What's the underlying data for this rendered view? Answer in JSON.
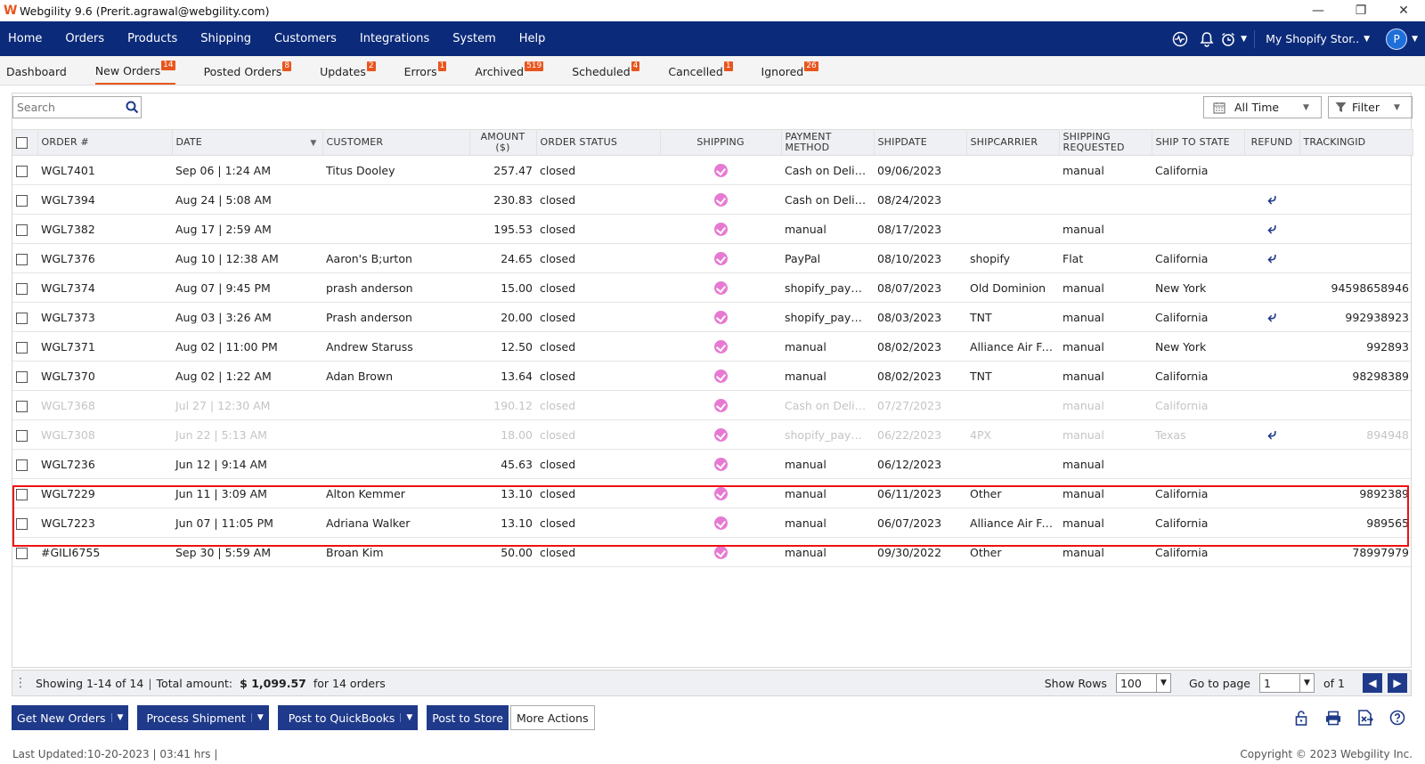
{
  "window": {
    "title": "Webgility 9.6 (Prerit.agrawal@webgility.com)",
    "minimize": "—",
    "restore": "❐",
    "close": "✕"
  },
  "nav": {
    "items": [
      "Home",
      "Orders",
      "Products",
      "Shipping",
      "Customers",
      "Integrations",
      "System",
      "Help"
    ],
    "store": "My Shopify Stor..",
    "avatar": "P"
  },
  "subtabs": [
    {
      "label": "Dashboard",
      "count": ""
    },
    {
      "label": "New Orders",
      "count": "14"
    },
    {
      "label": "Posted Orders",
      "count": "8"
    },
    {
      "label": "Updates",
      "count": "2"
    },
    {
      "label": "Errors",
      "count": "1"
    },
    {
      "label": "Archived",
      "count": "519"
    },
    {
      "label": "Scheduled",
      "count": "4"
    },
    {
      "label": "Cancelled",
      "count": "1"
    },
    {
      "label": "Ignored",
      "count": "26"
    }
  ],
  "toolbar": {
    "search_placeholder": "Search",
    "time_filter": "All Time",
    "filter_label": "Filter"
  },
  "columns": [
    "ORDER #",
    "DATE",
    "CUSTOMER",
    "AMOUNT ($)",
    "ORDER STATUS",
    "SHIPPING",
    "PAYMENT METHOD",
    "SHIPDATE",
    "SHIPCARRIER",
    "SHIPPING REQUESTED",
    "SHIP TO STATE",
    "REFUND",
    "TRACKINGID"
  ],
  "rows": [
    {
      "order": "WGL7401",
      "date": "Sep 06 | 1:24 AM",
      "customer": "Titus Dooley",
      "amount": "257.47",
      "status": "closed",
      "payment": "Cash on Deliv...",
      "shipdate": "09/06/2023",
      "carrier": "",
      "requested": "manual",
      "state": "California",
      "refund": false,
      "tracking": "",
      "faded": false
    },
    {
      "order": "WGL7394",
      "date": "Aug 24 | 5:08 AM",
      "customer": "",
      "amount": "230.83",
      "status": "closed",
      "payment": "Cash on Deliv...",
      "shipdate": "08/24/2023",
      "carrier": "",
      "requested": "",
      "state": "",
      "refund": true,
      "tracking": "",
      "faded": false
    },
    {
      "order": "WGL7382",
      "date": "Aug 17 | 2:59 AM",
      "customer": "",
      "amount": "195.53",
      "status": "closed",
      "payment": "manual",
      "shipdate": "08/17/2023",
      "carrier": "",
      "requested": "manual",
      "state": "",
      "refund": true,
      "tracking": "",
      "faded": false
    },
    {
      "order": "WGL7376",
      "date": "Aug 10 | 12:38 AM",
      "customer": "Aaron's B;urton",
      "amount": "24.65",
      "status": "closed",
      "payment": "PayPal",
      "shipdate": "08/10/2023",
      "carrier": "shopify",
      "requested": "Flat",
      "state": "California",
      "refund": true,
      "tracking": "",
      "faded": false
    },
    {
      "order": "WGL7374",
      "date": "Aug 07 | 9:45 PM",
      "customer": "prash anderson",
      "amount": "15.00",
      "status": "closed",
      "payment": "shopify_paym...",
      "shipdate": "08/07/2023",
      "carrier": "Old Dominion",
      "requested": "manual",
      "state": "New York",
      "refund": false,
      "tracking": "94598658946",
      "faded": false
    },
    {
      "order": "WGL7373",
      "date": "Aug 03 | 3:26 AM",
      "customer": "Prash anderson",
      "amount": "20.00",
      "status": "closed",
      "payment": "shopify_paym...",
      "shipdate": "08/03/2023",
      "carrier": "TNT",
      "requested": "manual",
      "state": "California",
      "refund": true,
      "tracking": "992938923",
      "faded": false
    },
    {
      "order": "WGL7371",
      "date": "Aug 02 | 11:00 PM",
      "customer": "Andrew Staruss",
      "amount": "12.50",
      "status": "closed",
      "payment": "manual",
      "shipdate": "08/02/2023",
      "carrier": "Alliance Air Fr...",
      "requested": "manual",
      "state": "New York",
      "refund": false,
      "tracking": "992893",
      "faded": false
    },
    {
      "order": "WGL7370",
      "date": "Aug 02 | 1:22 AM",
      "customer": "Adan Brown",
      "amount": "13.64",
      "status": "closed",
      "payment": "manual",
      "shipdate": "08/02/2023",
      "carrier": "TNT",
      "requested": "manual",
      "state": "California",
      "refund": false,
      "tracking": "98298389",
      "faded": false
    },
    {
      "order": "WGL7368",
      "date": "Jul 27 | 12:30 AM",
      "customer": "",
      "amount": "190.12",
      "status": "closed",
      "payment": "Cash on Deliv...",
      "shipdate": "07/27/2023",
      "carrier": "",
      "requested": "manual",
      "state": "California",
      "refund": false,
      "tracking": "",
      "faded": true
    },
    {
      "order": "WGL7308",
      "date": "Jun 22 | 5:13 AM",
      "customer": "",
      "amount": "18.00",
      "status": "closed",
      "payment": "shopify_paym...",
      "shipdate": "06/22/2023",
      "carrier": "4PX",
      "requested": "manual",
      "state": "Texas",
      "refund": true,
      "tracking": "894948",
      "faded": true
    },
    {
      "order": "WGL7236",
      "date": "Jun 12 | 9:14 AM",
      "customer": "",
      "amount": "45.63",
      "status": "closed",
      "payment": "manual",
      "shipdate": "06/12/2023",
      "carrier": "",
      "requested": "manual",
      "state": "",
      "refund": false,
      "tracking": "",
      "faded": false
    },
    {
      "order": "WGL7229",
      "date": "Jun 11 | 3:09 AM",
      "customer": "Alton Kemmer",
      "amount": "13.10",
      "status": "closed",
      "payment": "manual",
      "shipdate": "06/11/2023",
      "carrier": "Other",
      "requested": "manual",
      "state": "California",
      "refund": false,
      "tracking": "9892389",
      "faded": false
    },
    {
      "order": "WGL7223",
      "date": "Jun 07 | 11:05 PM",
      "customer": "Adriana Walker",
      "amount": "13.10",
      "status": "closed",
      "payment": "manual",
      "shipdate": "06/07/2023",
      "carrier": "Alliance Air Fr...",
      "requested": "manual",
      "state": "California",
      "refund": false,
      "tracking": "989565",
      "faded": false
    },
    {
      "order": "#GILI6755",
      "date": "Sep 30 | 5:59 AM",
      "customer": "Broan Kim",
      "amount": "50.00",
      "status": "closed",
      "payment": "manual",
      "shipdate": "09/30/2022",
      "carrier": "Other",
      "requested": "manual",
      "state": "California",
      "refund": false,
      "tracking": "78997979",
      "faded": false
    }
  ],
  "pager": {
    "showing": "Showing 1-14 of 14",
    "total_label": "Total amount:",
    "total_value": "$ 1,099.57",
    "total_suffix": "for 14 orders",
    "show_rows_label": "Show Rows",
    "show_rows_value": "100",
    "goto_label": "Go to page",
    "goto_value": "1",
    "of_label": "of 1"
  },
  "actions": {
    "get_new_orders": "Get New Orders",
    "process_shipment": "Process Shipment",
    "post_to_quickbooks": "Post to QuickBooks",
    "post_to_store": "Post to Store",
    "more_actions": "More Actions"
  },
  "footer": {
    "last_updated": "Last Updated:10-20-2023 | 03:41 hrs |",
    "copyright": "Copyright © 2023 Webgility Inc."
  },
  "colors": {
    "nav_bg": "#0b2a7a",
    "accent": "#e8561e",
    "button_bg": "#1f3a8a",
    "shipping_dot": "#e67ad3",
    "highlight": "#ee1111"
  }
}
